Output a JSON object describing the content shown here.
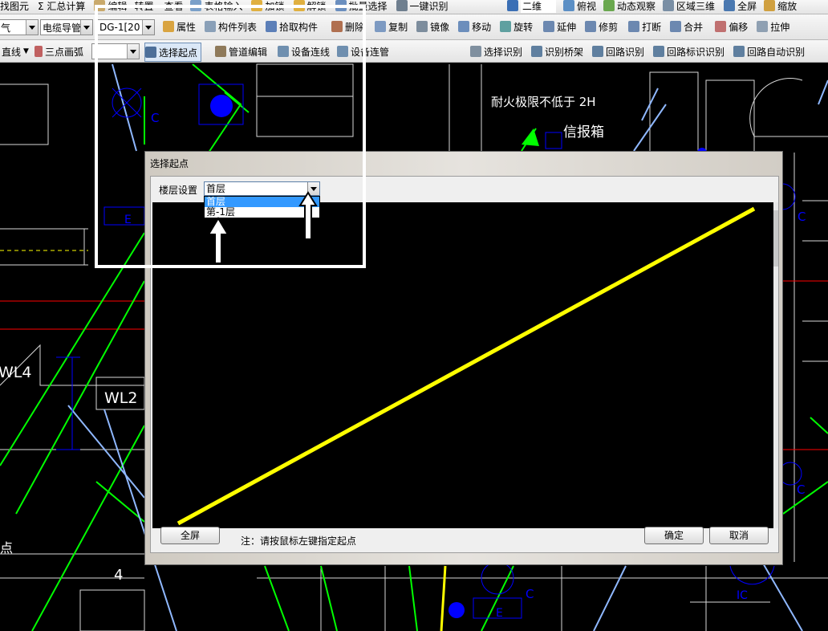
{
  "toolbar1": {
    "items": [
      "找图元",
      "Σ 汇总计算",
      "编辑",
      "转置",
      "查看",
      "表格输入",
      "加锁",
      "解锁",
      "批量选择",
      "一键识别"
    ],
    "view_items": [
      "二维",
      "俯视",
      "动态观察",
      "区域三维",
      "全屏",
      "缩放"
    ]
  },
  "toolbar2": {
    "combo1": "气",
    "combo2": "电缆导管",
    "combo3": "DG-1[20",
    "items": [
      "属性",
      "构件列表",
      "拾取构件",
      "删除",
      "复制",
      "镜像",
      "移动",
      "旋转",
      "延伸",
      "修剪",
      "打断",
      "合并",
      "偏移",
      "拉伸"
    ]
  },
  "toolbar3": {
    "draw_mode": "直线",
    "arc_mode": "三点画弧",
    "items": [
      "选择起点",
      "管道编辑",
      "设备连线",
      "设备连管",
      "选择识别",
      "识别桥架",
      "回路识别",
      "回路标识识别",
      "回路自动识别"
    ]
  },
  "cad_labels": {
    "fire_text": "耐火极限不低于 2H",
    "box_text": "信报箱",
    "wl4": "WL4",
    "wl2": "WL2",
    "num4": "4",
    "c": "C",
    "e": "E",
    "ic": "IC",
    "dian": "点"
  },
  "dialog": {
    "title": "选择起点",
    "floor_label": "楼层设置",
    "floor_selected": "首层",
    "floor_options": [
      "首层",
      "第-1层"
    ],
    "fullscreen_button": "全屏",
    "note": "注：请按鼠标左键指定起点",
    "ok_button": "确定",
    "cancel_button": "取消"
  },
  "colors": {
    "line_yellow": "#ffff00",
    "cad_green": "#00ff00",
    "cad_blue": "#0000ff",
    "cad_red": "#ff0000",
    "cad_lightblue": "#8fb8ff"
  }
}
